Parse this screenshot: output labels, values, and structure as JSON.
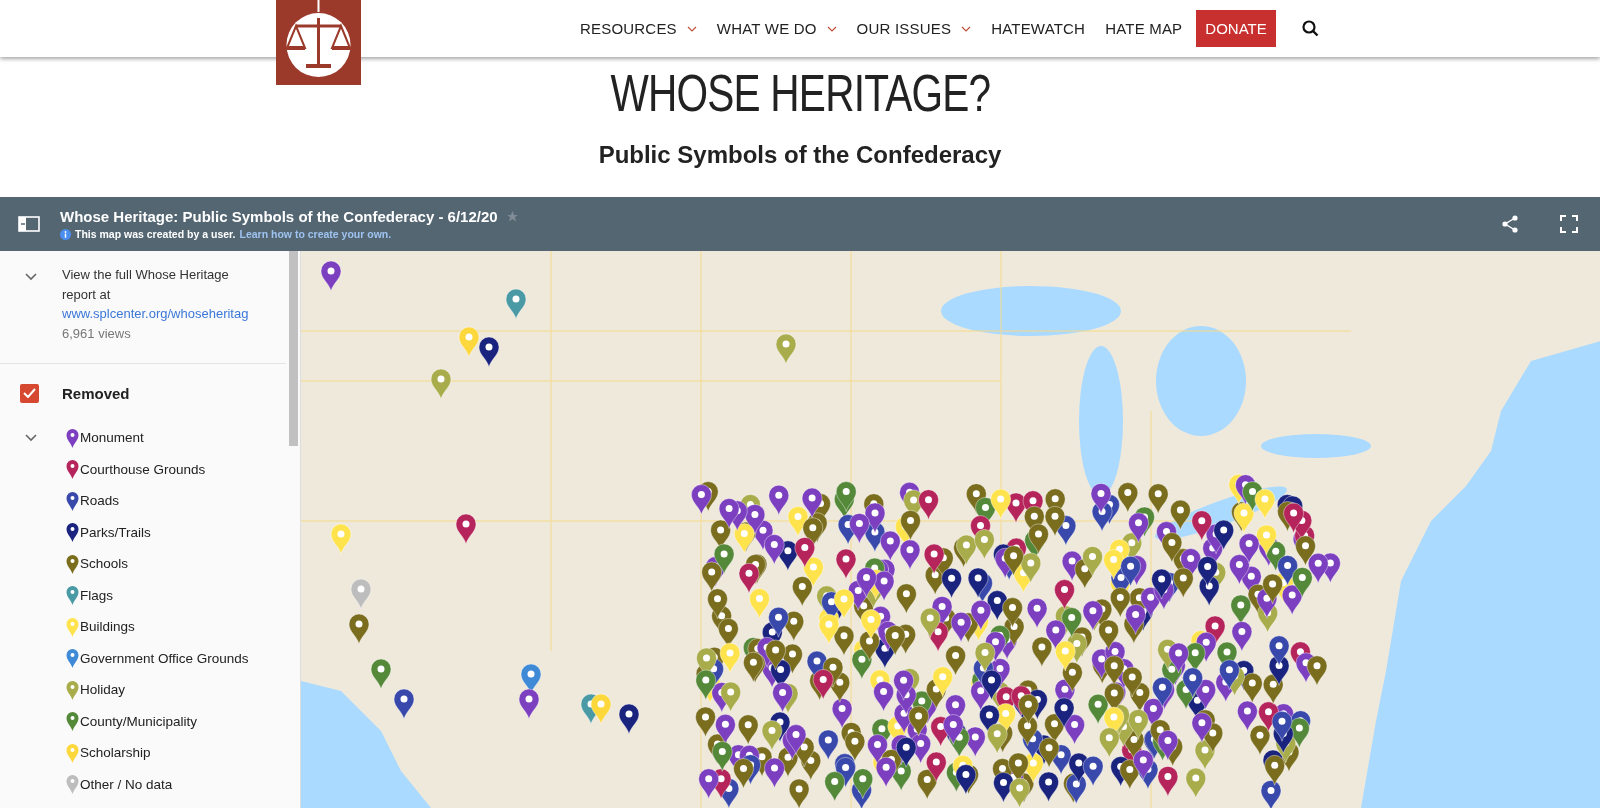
{
  "header": {
    "nav": [
      {
        "label": "RESOURCES",
        "dropdown": true
      },
      {
        "label": "WHAT WE DO",
        "dropdown": true
      },
      {
        "label": "OUR ISSUES",
        "dropdown": true
      },
      {
        "label": "HATEWATCH",
        "dropdown": false
      },
      {
        "label": "HATE MAP",
        "dropdown": false
      }
    ],
    "donate": "DONATE"
  },
  "title": "WHOSE HERITAGE?",
  "subtitle": "Public Symbols of the Confederacy",
  "map_embed": {
    "title": "Whose Heritage: Public Symbols of the Confederacy - 6/12/20",
    "starred": false,
    "notice": "This map was created by a user.",
    "notice_link": "Learn how to create your own.",
    "description": {
      "text": "View the full Whose Heritage report at",
      "link": "www.splcenter.org/whoseheritag",
      "views": "6,961 views"
    },
    "layer": {
      "name": "Removed",
      "checked": true,
      "items": [
        {
          "label": "Monument",
          "color": "#7b3fbf"
        },
        {
          "label": "Courthouse Grounds",
          "color": "#b5245a"
        },
        {
          "label": "Roads",
          "color": "#3949ab"
        },
        {
          "label": "Parks/Trails",
          "color": "#1a237e"
        },
        {
          "label": "Schools",
          "color": "#7a6e1e"
        },
        {
          "label": "Flags",
          "color": "#4a9aa5"
        },
        {
          "label": "Buildings",
          "color": "#ffe34d"
        },
        {
          "label": "Government Office Grounds",
          "color": "#3f8ad6"
        },
        {
          "label": "Holiday",
          "color": "#a8ac4a"
        },
        {
          "label": "County/Municipality",
          "color": "#55893a"
        },
        {
          "label": "Scholarship",
          "color": "#fcd83c"
        },
        {
          "label": "Other / No data",
          "color": "#bdbdbd"
        }
      ]
    }
  }
}
